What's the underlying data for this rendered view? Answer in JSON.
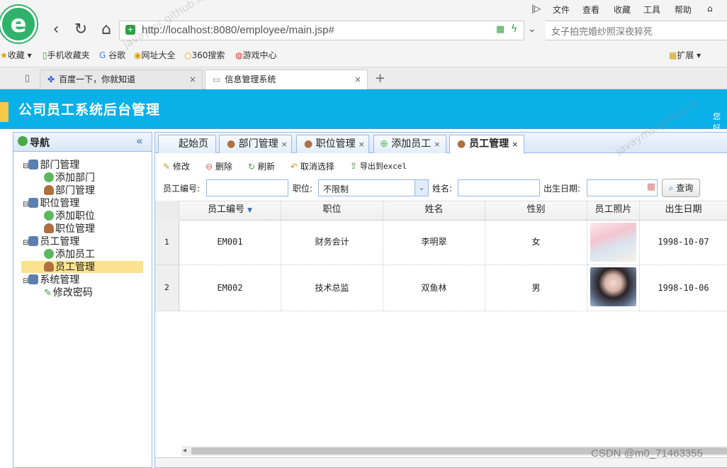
{
  "browser": {
    "menu": [
      "文件",
      "查看",
      "收藏",
      "工具",
      "帮助"
    ],
    "address": "http://localhost:8080/employee/main.jsp#",
    "address_host": "localhost",
    "search_placeholder": "女子拍完婚纱照深夜猝死",
    "bookmarks": [
      "收藏",
      "手机收藏夹",
      "谷歌",
      "网址大全",
      "360搜索",
      "游戏中心"
    ],
    "extensions_label": "扩展",
    "tabs": [
      {
        "label": "百度一下，你就知道",
        "active": false
      },
      {
        "label": "信息管理系统",
        "active": true
      }
    ],
    "new_tab": "+",
    "tab_close": "×"
  },
  "app": {
    "title": "公司员工系统后台管理",
    "header_right": "您好"
  },
  "nav": {
    "title": "导航",
    "collapse": "«",
    "tree": [
      {
        "label": "部门管理",
        "level": 0
      },
      {
        "label": "添加部门",
        "level": 1
      },
      {
        "label": "部门管理",
        "level": 1
      },
      {
        "label": "职位管理",
        "level": 0
      },
      {
        "label": "添加职位",
        "level": 1
      },
      {
        "label": "职位管理",
        "level": 1
      },
      {
        "label": "员工管理",
        "level": 0
      },
      {
        "label": "添加员工",
        "level": 1
      },
      {
        "label": "员工管理",
        "level": 1,
        "selected": true
      },
      {
        "label": "系统管理",
        "level": 0
      },
      {
        "label": "修改密码",
        "level": 1
      }
    ]
  },
  "main_tabs": [
    {
      "label": "起始页",
      "closable": false
    },
    {
      "label": "部门管理",
      "closable": true
    },
    {
      "label": "职位管理",
      "closable": true
    },
    {
      "label": "添加员工",
      "closable": true
    },
    {
      "label": "员工管理",
      "closable": true,
      "active": true
    }
  ],
  "toolbar": {
    "edit": "修改",
    "delete": "删除",
    "refresh": "刷新",
    "unselect": "取消选择",
    "export": "导出到excel"
  },
  "query": {
    "emp_no_label": "员工编号:",
    "position_label": "职位:",
    "position_value": "不限制",
    "name_label": "姓名:",
    "birth_label": "出生日期:",
    "search_button": "查询"
  },
  "grid": {
    "columns": [
      "员工编号",
      "职位",
      "姓名",
      "性别",
      "员工照片",
      "出生日期"
    ],
    "sort_indicator": "▼",
    "rows": [
      {
        "num": "1",
        "emp_no": "EM001",
        "position": "财务会计",
        "name": "李明翠",
        "gender": "女",
        "birth": "1998-10-07"
      },
      {
        "num": "2",
        "emp_no": "EM002",
        "position": "技术总监",
        "name": "双鱼林",
        "gender": "男",
        "birth": "1998-10-06"
      }
    ]
  },
  "watermark": {
    "csdn": "CSDN @m0_71463355",
    "site": "javayms.github.io"
  }
}
